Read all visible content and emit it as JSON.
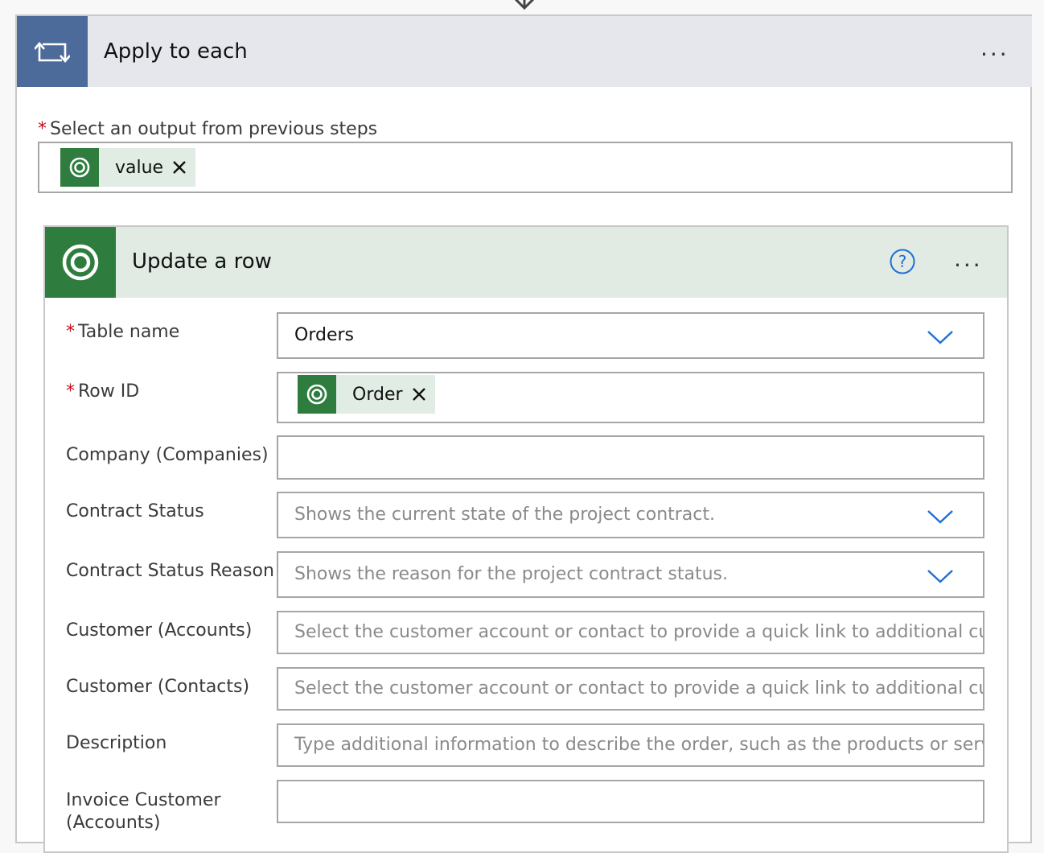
{
  "apply_to_each": {
    "title": "Apply to each",
    "more_label": "...",
    "select_output": {
      "label": "Select an output from previous steps",
      "required_mark": "*",
      "token": {
        "text": "value",
        "icon": "dataverse-icon"
      }
    }
  },
  "update_row": {
    "title": "Update a row",
    "more_label": "...",
    "fields": [
      {
        "label": "Table name",
        "required": true,
        "value": "Orders",
        "kind": "dropdown"
      },
      {
        "label": "Row ID",
        "required": true,
        "token": "Order",
        "kind": "token"
      },
      {
        "label": "Company (Companies)",
        "required": false,
        "value": "",
        "kind": "text"
      },
      {
        "label": "Contract Status",
        "required": false,
        "placeholder": "Shows the current state of the project contract.",
        "kind": "dropdown"
      },
      {
        "label": "Contract Status Reason",
        "required": false,
        "placeholder": "Shows the reason for the project contract status.",
        "kind": "dropdown"
      },
      {
        "label": "Customer (Accounts)",
        "required": false,
        "placeholder": "Select the customer account or contact to provide a quick link to additional cus",
        "kind": "text"
      },
      {
        "label": "Customer (Contacts)",
        "required": false,
        "placeholder": "Select the customer account or contact to provide a quick link to additional cus",
        "kind": "text"
      },
      {
        "label": "Description",
        "required": false,
        "placeholder": "Type additional information to describe the order, such as the products or servi",
        "kind": "text"
      },
      {
        "label_line1": "Invoice Customer",
        "label_line2": "(Accounts)",
        "required": false,
        "value": "",
        "kind": "text"
      }
    ]
  },
  "colors": {
    "loop_header": "#4c6b9a",
    "dataverse_green": "#2e7d3e",
    "required": "#c50f1f",
    "chevron": "#1f6fd6"
  }
}
